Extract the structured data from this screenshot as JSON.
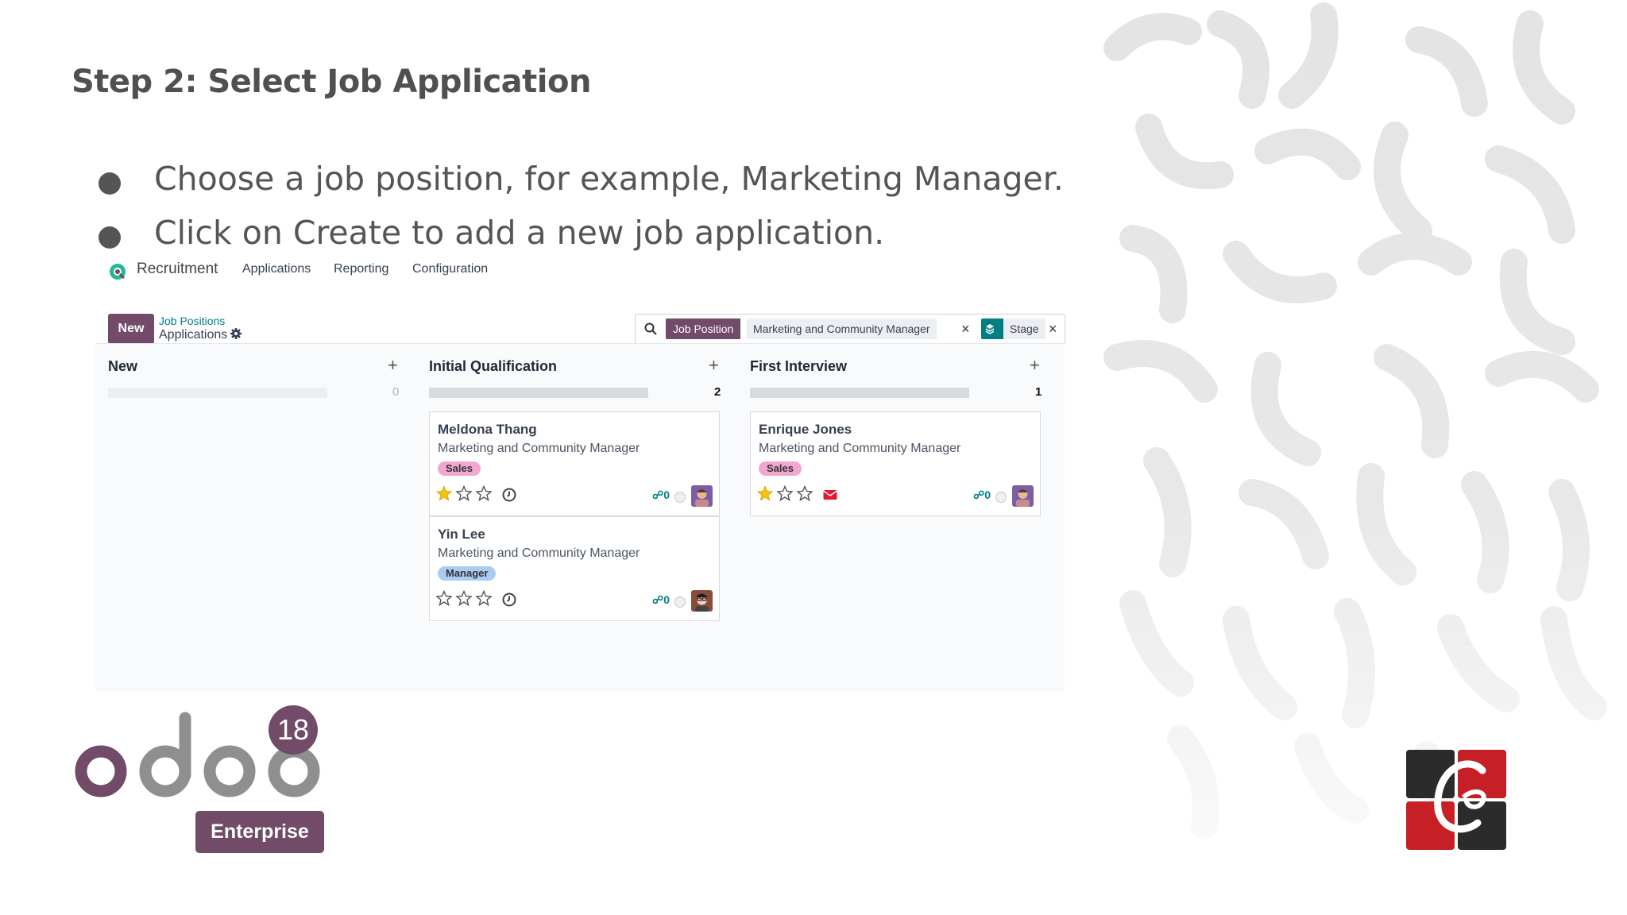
{
  "slide": {
    "title": "Step 2: Select Job Application",
    "bullets": [
      "Choose a job position, for example, Marketing Manager.",
      "Click on Create to add a new job application."
    ]
  },
  "odoo_ui": {
    "navbar": {
      "app_name": "Recruitment",
      "menu": [
        "Applications",
        "Reporting",
        "Configuration"
      ]
    },
    "control_panel": {
      "new_button": "New",
      "breadcrumb_parent": "Job Positions",
      "breadcrumb_current": "Applications"
    },
    "search": {
      "facets": [
        {
          "label": "Job Position",
          "value": "Marketing and Community Manager",
          "color": "#714B67"
        },
        {
          "label": "",
          "value": "Stage",
          "color": "#017e84",
          "icon": "layers-icon"
        }
      ]
    },
    "columns": [
      {
        "title": "New",
        "count": "0",
        "cards": []
      },
      {
        "title": "Initial Qualification",
        "count": "2",
        "cards": [
          {
            "name": "Meldona Thang",
            "job": "Marketing and Community Manager",
            "tag": "Sales",
            "stars": 1,
            "activity": "clock-icon",
            "attachments": "0"
          },
          {
            "name": "Yin Lee",
            "job": "Marketing and Community Manager",
            "tag": "Manager",
            "stars": 0,
            "activity": "clock-icon",
            "attachments": "0"
          }
        ]
      },
      {
        "title": "First Interview",
        "count": "1",
        "cards": [
          {
            "name": "Enrique Jones",
            "job": "Marketing and Community Manager",
            "tag": "Sales",
            "stars": 1,
            "activity": "envelope-icon",
            "attachments": "0"
          }
        ]
      }
    ]
  },
  "branding": {
    "logo_text": "odoo",
    "version": "18",
    "edition": "Enterprise",
    "accent": "#714B67"
  }
}
